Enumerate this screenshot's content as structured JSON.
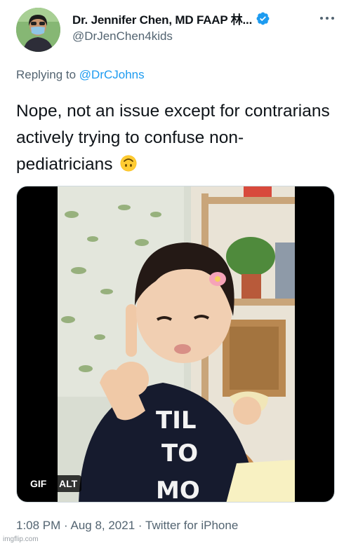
{
  "author": {
    "name": "Dr. Jennifer Chen, MD FAAP 林...",
    "handle": "@DrJenChen4kids",
    "verified": true
  },
  "reply": {
    "prefix": "Replying to ",
    "mention": "@DrCJohns"
  },
  "tweet": {
    "text": "Nope, not an issue except for contrarians actively trying to confuse non-pediatricians",
    "emoji": "upside-down-face"
  },
  "media": {
    "badges": {
      "gif": "GIF",
      "alt": "ALT"
    },
    "shirt_text": [
      "TIL",
      "TO",
      "MO"
    ]
  },
  "meta": {
    "time": "1:08 PM",
    "sep1": " · ",
    "date": "Aug 8, 2021",
    "sep2": " · ",
    "source": "Twitter for iPhone"
  },
  "watermark": "imgflip.com",
  "colors": {
    "text": "#0f1419",
    "secondary": "#536471",
    "link": "#1d9bf0",
    "verified": "#1d9bf0"
  }
}
